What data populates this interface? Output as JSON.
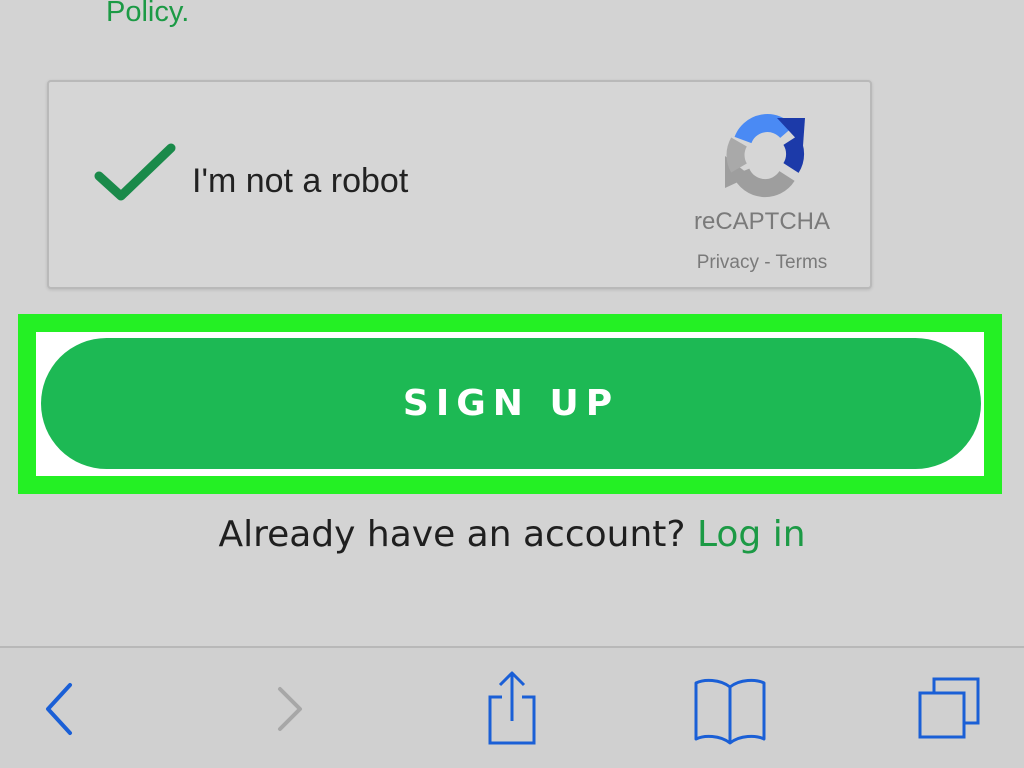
{
  "top": {
    "policy_text": "Policy."
  },
  "captcha": {
    "label": "I'm not a robot",
    "checked": true,
    "brand": "reCAPTCHA",
    "privacy_label": "Privacy",
    "separator": " - ",
    "terms_label": "Terms"
  },
  "signup": {
    "button_label": "SIGN UP"
  },
  "login": {
    "prompt": "Already have an account? ",
    "link_label": "Log in"
  },
  "toolbar": {
    "items": [
      {
        "icon": "back-icon",
        "enabled": true
      },
      {
        "icon": "forward-icon",
        "enabled": false
      },
      {
        "icon": "share-icon",
        "enabled": true
      },
      {
        "icon": "bookmarks-icon",
        "enabled": true
      },
      {
        "icon": "tabs-icon",
        "enabled": true
      }
    ]
  },
  "colors": {
    "brand_green": "#1db954",
    "link_green": "#1c9a45",
    "highlight_green": "#24f024",
    "toolbar_blue": "#1a5fd6",
    "disabled_gray": "#a7a7a7"
  }
}
